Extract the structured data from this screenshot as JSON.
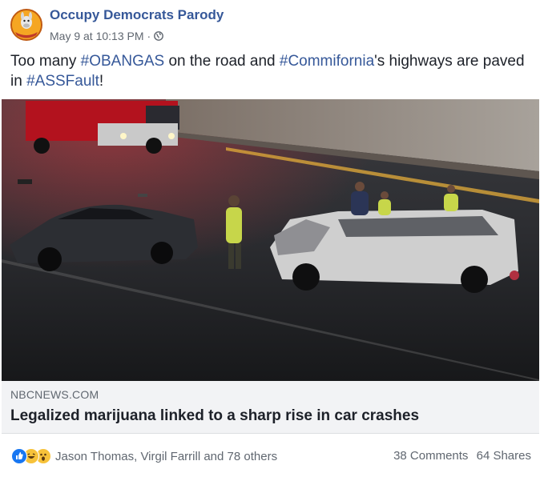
{
  "post": {
    "page_name": "Occupy Democrats Parody",
    "timestamp": "May 9 at 10:13 PM",
    "separator": "·",
    "avatar_text": "DONKEY LIES",
    "status_segments": [
      {
        "text": "Too many ",
        "hashtag": false
      },
      {
        "text": "#OBANGAS",
        "hashtag": true
      },
      {
        "text": " on the road and ",
        "hashtag": false
      },
      {
        "text": "#Commifornia",
        "hashtag": true
      },
      {
        "text": "'s highways are paved in ",
        "hashtag": false
      },
      {
        "text": "#ASSFault",
        "hashtag": true
      },
      {
        "text": "!",
        "hashtag": false
      }
    ]
  },
  "link": {
    "domain": "NBCNEWS.COM",
    "title": "Legalized marijuana linked to a sharp rise in car crashes"
  },
  "footer": {
    "reaction_icons": [
      "like-icon",
      "haha-icon",
      "wow-icon"
    ],
    "reactors": "Jason Thomas, Virgil Farrill and 78 others",
    "comments": "38 Comments",
    "shares": "64 Shares"
  },
  "colors": {
    "link_blue": "#365899",
    "meta_gray": "#606770",
    "text": "#1d2129",
    "card_bg": "#f2f3f5"
  }
}
